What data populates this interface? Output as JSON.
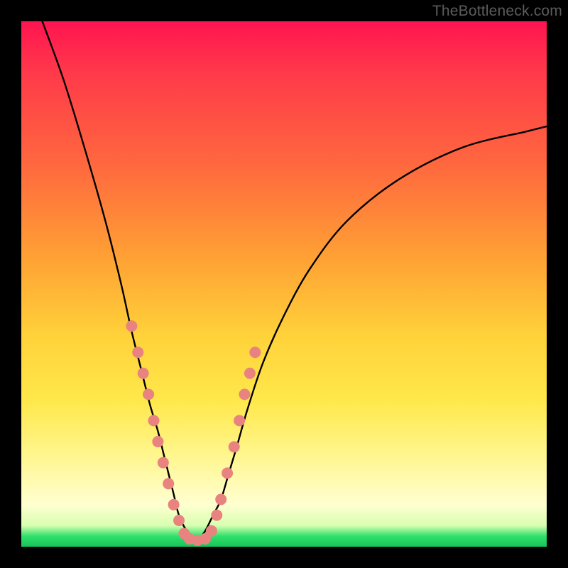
{
  "watermark": "TheBottleneck.com",
  "chart_data": {
    "type": "line",
    "title": "",
    "xlabel": "",
    "ylabel": "",
    "xlim": [
      0,
      100
    ],
    "ylim": [
      0,
      100
    ],
    "grid": false,
    "legend": false,
    "series": [
      {
        "name": "left-lobe",
        "x": [
          4,
          8,
          12,
          16,
          19,
          21,
          23,
          24.5,
          26,
          27,
          28,
          29,
          30,
          31.5,
          33.5
        ],
        "y": [
          100,
          89,
          76,
          62,
          50,
          41,
          33,
          27,
          22,
          18,
          14,
          10,
          6,
          3,
          1
        ]
      },
      {
        "name": "right-lobe",
        "x": [
          33.5,
          35,
          36.5,
          38,
          39.5,
          41,
          43,
          46,
          50,
          55,
          62,
          72,
          84,
          96,
          100
        ],
        "y": [
          1,
          3,
          6,
          9,
          14,
          19,
          26,
          35,
          44,
          53,
          62,
          70,
          76,
          79,
          80
        ]
      }
    ],
    "markers": {
      "name": "pink-dots",
      "color": "#e9837f",
      "points": [
        {
          "x": 21.0,
          "y": 42
        },
        {
          "x": 22.2,
          "y": 37
        },
        {
          "x": 23.2,
          "y": 33
        },
        {
          "x": 24.2,
          "y": 29
        },
        {
          "x": 25.2,
          "y": 24
        },
        {
          "x": 26.0,
          "y": 20
        },
        {
          "x": 27.0,
          "y": 16
        },
        {
          "x": 28.0,
          "y": 12
        },
        {
          "x": 29.0,
          "y": 8
        },
        {
          "x": 30.0,
          "y": 5
        },
        {
          "x": 31.0,
          "y": 2.5
        },
        {
          "x": 32.0,
          "y": 1.5
        },
        {
          "x": 33.5,
          "y": 1.2
        },
        {
          "x": 35.0,
          "y": 1.5
        },
        {
          "x": 36.2,
          "y": 3
        },
        {
          "x": 37.2,
          "y": 6
        },
        {
          "x": 38.0,
          "y": 9
        },
        {
          "x": 39.2,
          "y": 14
        },
        {
          "x": 40.5,
          "y": 19
        },
        {
          "x": 41.5,
          "y": 24
        },
        {
          "x": 42.5,
          "y": 29
        },
        {
          "x": 43.5,
          "y": 33
        },
        {
          "x": 44.5,
          "y": 37
        }
      ]
    }
  }
}
